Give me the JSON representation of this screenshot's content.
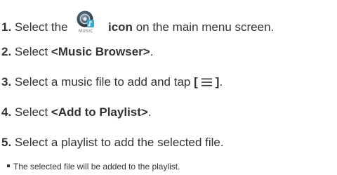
{
  "steps": [
    {
      "number": "1.",
      "before": "Select the",
      "icon_name": "music-player-icon",
      "icon_caption": "MUSIC",
      "bold": "icon",
      "after": "on the main menu screen."
    },
    {
      "number": "2.",
      "before": "Select",
      "bold": "<Music Browser>",
      "after": "."
    },
    {
      "number": "3.",
      "before": "Select a music file to add and tap",
      "bold_open": "[",
      "menu_icon_name": "menu-lines-icon",
      "bold_close": "]",
      "after": "."
    },
    {
      "number": "4.",
      "before": "Select",
      "bold": "<Add to Playlist>",
      "after": "."
    },
    {
      "number": "5.",
      "before": "Select a playlist to add the selected file."
    }
  ],
  "note": "The selected file will be added to the playlist.",
  "colors": {
    "text": "#333333",
    "icon_ring_dark": "#2b3a47",
    "icon_ring_light": "#8fa2b0",
    "icon_badge": "#3fa9d6"
  }
}
